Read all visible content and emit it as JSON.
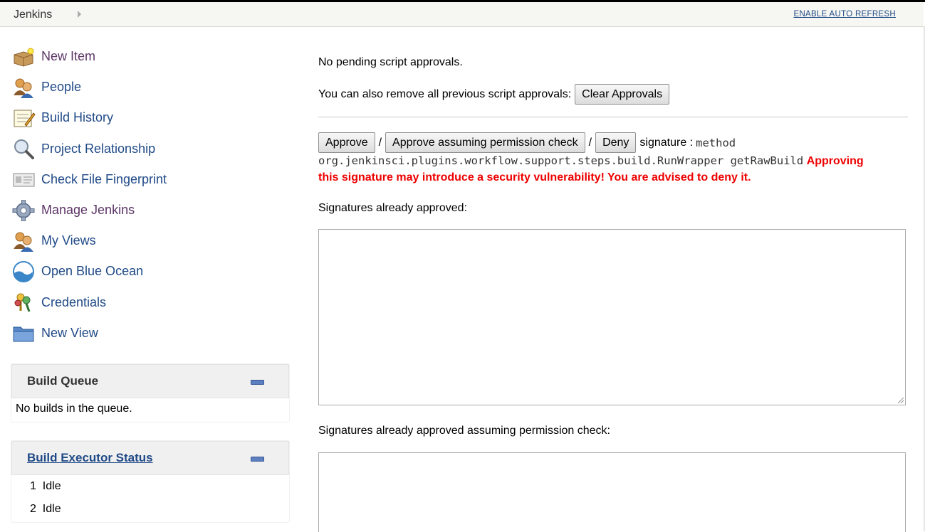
{
  "header": {
    "breadcrumb": "Jenkins",
    "auto_refresh": "ENABLE AUTO REFRESH"
  },
  "sidebar": {
    "items": [
      {
        "label": "New Item",
        "icon": "new-item-icon"
      },
      {
        "label": "People",
        "icon": "people-icon"
      },
      {
        "label": "Build History",
        "icon": "notepad-icon"
      },
      {
        "label": "Project Relationship",
        "icon": "magnifier-icon"
      },
      {
        "label": "Check File Fingerprint",
        "icon": "fingerprint-icon"
      },
      {
        "label": "Manage Jenkins",
        "icon": "gear-icon"
      },
      {
        "label": "My Views",
        "icon": "people-icon"
      },
      {
        "label": "Open Blue Ocean",
        "icon": "blue-ocean-icon"
      },
      {
        "label": "Credentials",
        "icon": "keys-icon"
      },
      {
        "label": "New View",
        "icon": "folder-icon"
      }
    ]
  },
  "build_queue": {
    "title": "Build Queue",
    "empty_text": "No builds in the queue."
  },
  "executor_status": {
    "title": "Build Executor Status",
    "executors": [
      {
        "num": "1",
        "status": "Idle"
      },
      {
        "num": "2",
        "status": "Idle"
      }
    ]
  },
  "main": {
    "no_pending": "No pending script approvals.",
    "remove_text": "You can also remove all previous script approvals:",
    "clear_button": "Clear Approvals",
    "approve_button": "Approve",
    "approve_perm_button": "Approve assuming permission check",
    "deny_button": "Deny",
    "slash": "/",
    "signature_label": "signature :",
    "signature_method": "method",
    "signature_value": "org.jenkinsci.plugins.workflow.support.steps.build.RunWrapper getRawBuild",
    "warning_1": "Approving",
    "warning_2": "this signature may introduce a security vulnerability! You are advised to deny it.",
    "approved_label": "Signatures already approved:",
    "approved_perm_label": "Signatures already approved assuming permission check:"
  },
  "colors": {
    "link": "#204a87",
    "visited": "#5c3566",
    "warning": "#ee0000"
  }
}
